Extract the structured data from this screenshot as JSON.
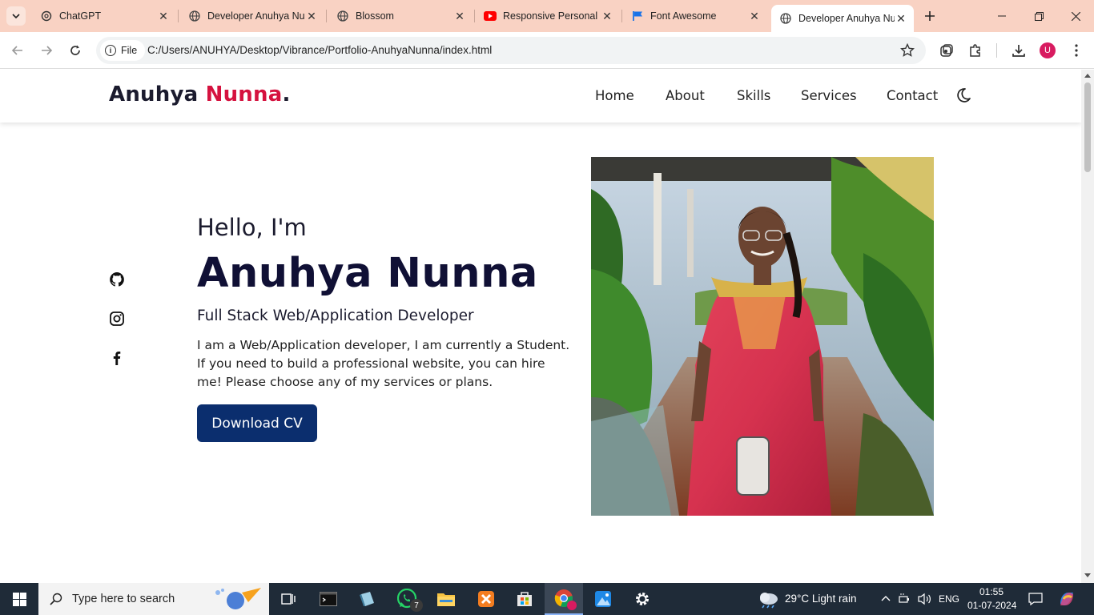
{
  "browser": {
    "tabs": [
      {
        "title": "ChatGPT",
        "icon": "chatgpt-icon"
      },
      {
        "title": "Developer Anuhya Nu",
        "icon": "globe-icon"
      },
      {
        "title": "Blossom",
        "icon": "globe-icon"
      },
      {
        "title": "Responsive Personal P",
        "icon": "youtube-icon"
      },
      {
        "title": "Font Awesome",
        "icon": "font-awesome-icon"
      },
      {
        "title": "Developer Anuhya Nu",
        "icon": "globe-icon",
        "active": true
      }
    ],
    "address": {
      "chip_label": "File",
      "url": "C:/Users/ANUHYA/Desktop/Vibrance/Portfolio-AnuhyaNunna/index.html"
    },
    "profile_initial": "U"
  },
  "site": {
    "logo": {
      "first": "Anuhya ",
      "accent": "Nunna",
      "dot": "."
    },
    "nav": [
      "Home",
      "About",
      "Skills",
      "Services",
      "Contact"
    ],
    "hero": {
      "greeting": "Hello, I'm",
      "name": "Anuhya Nunna",
      "role": "Full Stack Web/Application Developer",
      "description": "I am a Web/Application developer, I am currently a Student. If you need to build a professional website, you can hire me! Please choose any of my services or plans.",
      "cta": "Download CV"
    },
    "social": [
      "github-icon",
      "instagram-icon",
      "facebook-icon"
    ],
    "colors": {
      "accent": "#d5123f",
      "button": "#0b2e6e",
      "tabbar": "#f9d2c3"
    }
  },
  "taskbar": {
    "search_placeholder": "Type here to search",
    "weather": "29°C  Light rain",
    "language": "ENG",
    "time": "01:55",
    "date": "01-07-2024",
    "whatsapp_badge": "7"
  }
}
